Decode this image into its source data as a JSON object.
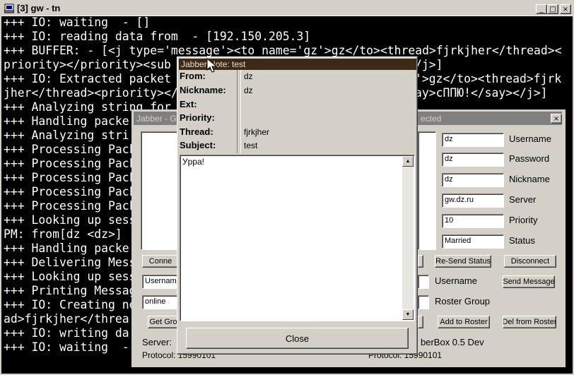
{
  "terminal": {
    "title": "[3] gw - tn",
    "controls": {
      "minimize": "_",
      "maximize": "□",
      "close": "×"
    },
    "lines": [
      "+++ IO: waiting  - []",
      "+++ IO: reading data from  - [192.150.205.3]",
      "+++ BUFFER: - [<j type='message'><to name='gz'>gz</to><thread>fjrkjher</thread><",
      "priority></priority><sub",
      "+++ IO: Extracted packet",
      "jher</thread><priority></",
      "+++ Analyzing string for",
      "+++ Handling packe",
      "+++ Analyzing stri",
      "+++ Processing Pack",
      "+++ Processing Pack",
      "+++ Processing Pack",
      "+++ Processing Pack",
      "+++ Processing Pack",
      "+++ Looking up sess",
      "PM: from[dz <dz>]",
      "+++ Handling packe",
      "+++ Delivering Mess",
      "+++ Looking up sess",
      "+++ Printing Messag",
      "+++ IO: Creating ne",
      "ad>fjrkjher</threa",
      "+++ IO: writing da",
      "+++ IO: waiting  -"
    ],
    "right_fragments": [
      {
        "line": 3,
        "text": "/j>]"
      },
      {
        "line": 4,
        "text": "'>gz</to><thread>fjrk"
      },
      {
        "line": 5,
        "text": "ay>cППЮ!</say></j>]"
      }
    ]
  },
  "jabber": {
    "title_left": "Jabber - G",
    "title_right": "ected",
    "close_glyph": "×",
    "fields": {
      "username": {
        "label": "Username",
        "value": "dz"
      },
      "password": {
        "label": "Password",
        "value": "dz"
      },
      "nickname": {
        "label": "Nickname",
        "value": "dz"
      },
      "server": {
        "label": "Server",
        "value": "gw.dz.ru"
      },
      "priority": {
        "label": "Priority",
        "value": "10"
      },
      "status": {
        "label": "Status",
        "value": "Married"
      }
    },
    "buttons": {
      "connect": "Conne",
      "resend_status": "Re-Send Status",
      "disconnect": "Disconnect",
      "send_message": "Send Message",
      "get_groups": "Get Gro",
      "add_to_roster": "Add to Roster",
      "del_from_roster": "Del from Roster"
    },
    "inputs": {
      "username_input": "Username",
      "status_input": "online"
    },
    "labels": {
      "username": "Username",
      "roster_group": "Roster Group",
      "server": "Server:",
      "protocol": "Protocol: 15990101",
      "right_info_1": "berBox 0.5 Dev",
      "right_info_2": "Protocol: 15990101"
    }
  },
  "note": {
    "title": "Jabber Note: test",
    "fields": [
      {
        "key": "From:",
        "value": "dz"
      },
      {
        "key": "Nickname:",
        "value": "dz"
      },
      {
        "key": "Ext:",
        "value": ""
      },
      {
        "key": "Priority:",
        "value": ""
      },
      {
        "key": "Thread:",
        "value": "fjrkjher"
      },
      {
        "key": "Subject:",
        "value": "test"
      }
    ],
    "body": "Уppa!",
    "close_button": "Close"
  }
}
